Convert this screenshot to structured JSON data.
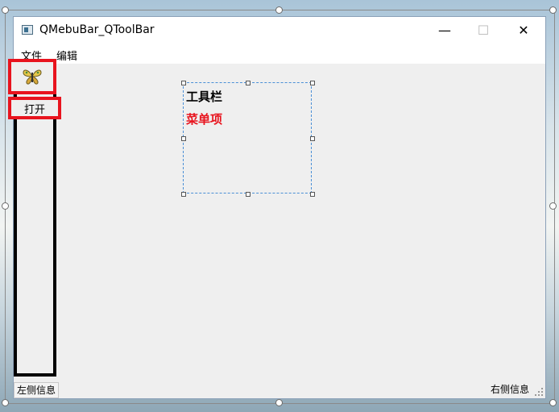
{
  "window": {
    "title": "QMebuBar_QToolBar",
    "controls": {
      "minimize": "—",
      "maximize": "☐",
      "close": "✕"
    }
  },
  "menubar": {
    "items": [
      {
        "label": "文件"
      },
      {
        "label": "编辑"
      }
    ]
  },
  "toolbar": {
    "actions": [
      {
        "icon": "butterfly-icon"
      },
      {
        "label": "打开"
      }
    ],
    "highlight_color": "#e8141e"
  },
  "annotation": {
    "line1": "工具栏",
    "line2": "菜单项",
    "line1_color": "#000000",
    "line2_color": "#e8141e"
  },
  "statusbar": {
    "left": "左侧信息",
    "right": "右侧信息"
  }
}
